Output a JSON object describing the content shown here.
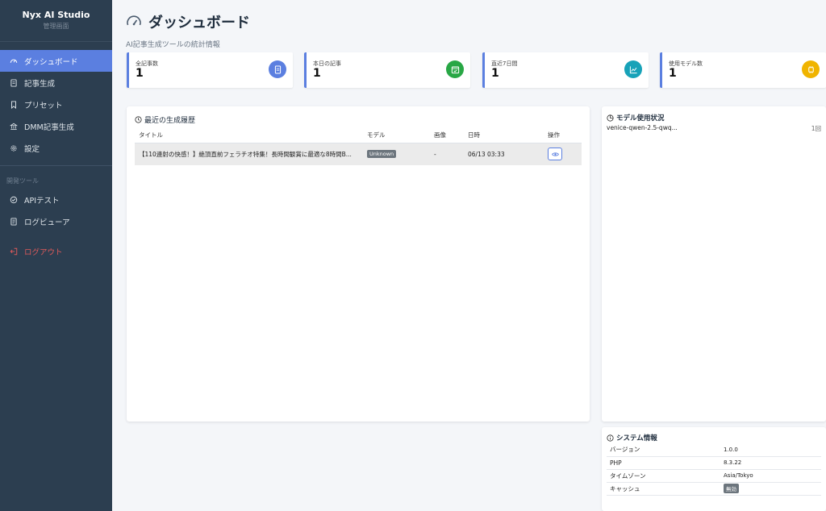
{
  "brand": {
    "title": "Nyx AI Studio",
    "subtitle": "管理画面"
  },
  "sidebar": {
    "items": [
      {
        "label": "ダッシュボード",
        "icon": "speedometer-icon"
      },
      {
        "label": "記事生成",
        "icon": "document-icon"
      },
      {
        "label": "プリセット",
        "icon": "bookmark-icon"
      },
      {
        "label": "DMM記事生成",
        "icon": "building-icon"
      },
      {
        "label": "設定",
        "icon": "gear-icon"
      }
    ],
    "dev_section": "開発ツール",
    "dev_items": [
      {
        "label": "APIテスト",
        "icon": "check-circle-icon"
      },
      {
        "label": "ログビューア",
        "icon": "log-icon"
      }
    ],
    "logout": "ログアウト"
  },
  "header": {
    "title": "ダッシュボード",
    "subtitle": "AI記事生成ツールの統計情報"
  },
  "stats": [
    {
      "label": "全記事数",
      "value": "1",
      "icon": "document-icon",
      "color": "#5b7fe0"
    },
    {
      "label": "本日の記事",
      "value": "1",
      "icon": "calendar-check-icon",
      "color": "#28a745"
    },
    {
      "label": "直近7日間",
      "value": "1",
      "icon": "chart-line-icon",
      "color": "#17a2b8"
    },
    {
      "label": "使用モデル数",
      "value": "1",
      "icon": "cpu-icon",
      "color": "#f0b400"
    }
  ],
  "history": {
    "title": "最近の生成履歴",
    "columns": [
      "タイトル",
      "モデル",
      "画像",
      "日時",
      "操作"
    ],
    "rows": [
      {
        "title": "【110連射の快感！】絶頂直前フェラチオ特集！長時間観賞に最適な8時間B...",
        "model": "Unknown",
        "image": "-",
        "date": "06/13 03:33"
      }
    ]
  },
  "models": {
    "title": "モデル使用状況",
    "rows": [
      {
        "name": "venice-qwen-2.5-qwq...",
        "count": "1回"
      }
    ]
  },
  "system": {
    "title": "システム情報",
    "rows": [
      {
        "key": "バージョン",
        "value": "1.0.0"
      },
      {
        "key": "PHP",
        "value": "8.3.22"
      },
      {
        "key": "タイムゾーン",
        "value": "Asia/Tokyo"
      },
      {
        "key": "キャッシュ",
        "value": "無効"
      }
    ]
  }
}
